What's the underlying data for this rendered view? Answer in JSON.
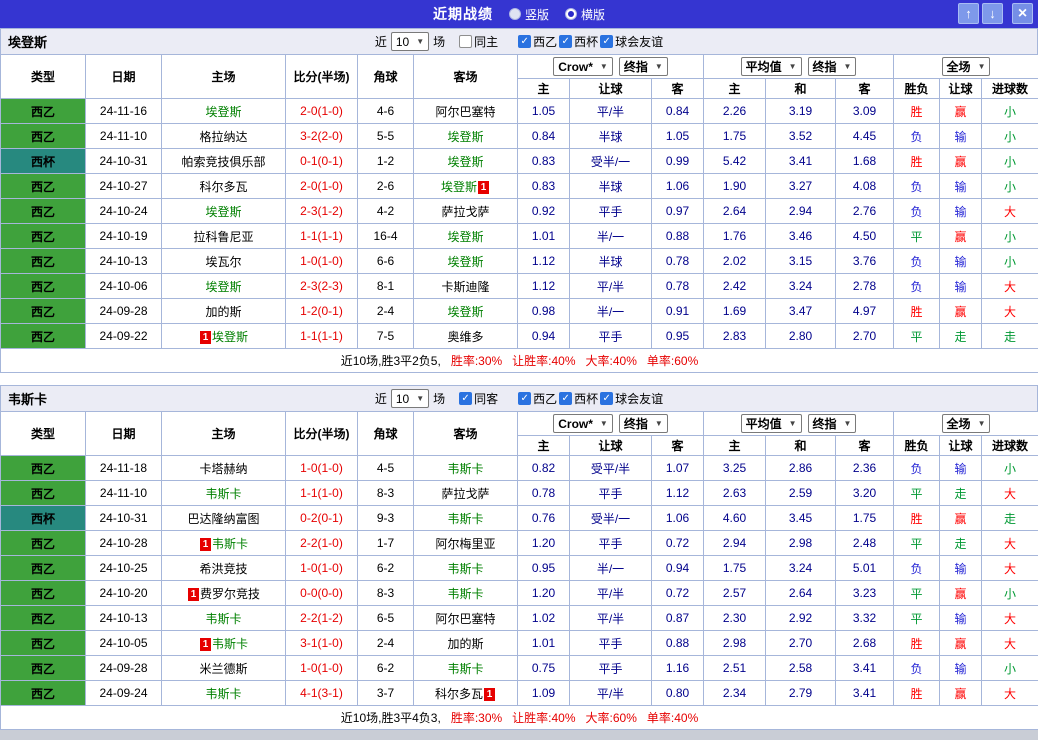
{
  "titlebar": {
    "title": "近期战绩",
    "radio_vertical": "竖版",
    "radio_horizontal": "横版",
    "selected_layout": "横版",
    "up_icon": "↑",
    "down_icon": "↓",
    "close_icon": "×"
  },
  "filter": {
    "near_label": "近",
    "near_value": "10",
    "games_label": "场",
    "leagues": [
      {
        "label": "西乙",
        "checked": true
      },
      {
        "label": "西杯",
        "checked": true
      },
      {
        "label": "球会友谊",
        "checked": true
      }
    ]
  },
  "columns": {
    "main": [
      "类型",
      "日期",
      "主场",
      "比分(半场)",
      "角球",
      "客场"
    ],
    "asia": [
      "主",
      "让球",
      "客"
    ],
    "europe": [
      "主",
      "和",
      "客"
    ],
    "result": [
      "胜负",
      "让球",
      "进球数"
    ]
  },
  "odds_header": {
    "bookmaker": "Crow*",
    "asia_final": "终指",
    "average": "平均值",
    "europe_final": "终指",
    "scope": "全场"
  },
  "colors": {
    "accent": "#3535d1",
    "score": "#e60000",
    "focus_team": "#008000",
    "odds": "#00008b",
    "summary_stat": "#e60000",
    "league_map": {
      "西乙": "#3fa23c",
      "西杯": "#27897f"
    },
    "result_map": {
      "胜": "#ff0000",
      "赢": "#ff0000",
      "大": "#ff0000",
      "负": "#2323d5",
      "输": "#2323d5",
      "平": "#009933",
      "走": "#009933",
      "小": "#009933"
    }
  },
  "sections": [
    {
      "team": "埃登斯",
      "same": {
        "label": "同主",
        "checked": false
      },
      "rows": [
        {
          "lg": "西乙",
          "date": "24-11-16",
          "home": "埃登斯",
          "hb": "",
          "score": "2-0(1-0)",
          "cor": "4-6",
          "away": "阿尔巴塞特",
          "ab": "",
          "asia": [
            "1.05",
            "平/半",
            "0.84"
          ],
          "eu": [
            "2.26",
            "3.19",
            "3.09"
          ],
          "res": [
            "胜",
            "赢",
            "小"
          ]
        },
        {
          "lg": "西乙",
          "date": "24-11-10",
          "home": "格拉纳达",
          "hb": "",
          "score": "3-2(2-0)",
          "cor": "5-5",
          "away": "埃登斯",
          "ab": "",
          "asia": [
            "0.84",
            "半球",
            "1.05"
          ],
          "eu": [
            "1.75",
            "3.52",
            "4.45"
          ],
          "res": [
            "负",
            "输",
            "小"
          ]
        },
        {
          "lg": "西杯",
          "date": "24-10-31",
          "home": "帕索竞技俱乐部",
          "hb": "",
          "score": "0-1(0-1)",
          "cor": "1-2",
          "away": "埃登斯",
          "ab": "",
          "asia": [
            "0.83",
            "受半/一",
            "0.99"
          ],
          "eu": [
            "5.42",
            "3.41",
            "1.68"
          ],
          "res": [
            "胜",
            "赢",
            "小"
          ]
        },
        {
          "lg": "西乙",
          "date": "24-10-27",
          "home": "科尔多瓦",
          "hb": "",
          "score": "2-0(1-0)",
          "cor": "2-6",
          "away": "埃登斯",
          "ab": "1",
          "asia": [
            "0.83",
            "半球",
            "1.06"
          ],
          "eu": [
            "1.90",
            "3.27",
            "4.08"
          ],
          "res": [
            "负",
            "输",
            "小"
          ]
        },
        {
          "lg": "西乙",
          "date": "24-10-24",
          "home": "埃登斯",
          "hb": "",
          "score": "2-3(1-2)",
          "cor": "4-2",
          "away": "萨拉戈萨",
          "ab": "",
          "asia": [
            "0.92",
            "平手",
            "0.97"
          ],
          "eu": [
            "2.64",
            "2.94",
            "2.76"
          ],
          "res": [
            "负",
            "输",
            "大"
          ]
        },
        {
          "lg": "西乙",
          "date": "24-10-19",
          "home": "拉科鲁尼亚",
          "hb": "",
          "score": "1-1(1-1)",
          "cor": "16-4",
          "away": "埃登斯",
          "ab": "",
          "asia": [
            "1.01",
            "半/一",
            "0.88"
          ],
          "eu": [
            "1.76",
            "3.46",
            "4.50"
          ],
          "res": [
            "平",
            "赢",
            "小"
          ]
        },
        {
          "lg": "西乙",
          "date": "24-10-13",
          "home": "埃瓦尔",
          "hb": "",
          "score": "1-0(1-0)",
          "cor": "6-6",
          "away": "埃登斯",
          "ab": "",
          "asia": [
            "1.12",
            "半球",
            "0.78"
          ],
          "eu": [
            "2.02",
            "3.15",
            "3.76"
          ],
          "res": [
            "负",
            "输",
            "小"
          ]
        },
        {
          "lg": "西乙",
          "date": "24-10-06",
          "home": "埃登斯",
          "hb": "",
          "score": "2-3(2-3)",
          "cor": "8-1",
          "away": "卡斯迪隆",
          "ab": "",
          "asia": [
            "1.12",
            "平/半",
            "0.78"
          ],
          "eu": [
            "2.42",
            "3.24",
            "2.78"
          ],
          "res": [
            "负",
            "输",
            "大"
          ]
        },
        {
          "lg": "西乙",
          "date": "24-09-28",
          "home": "加的斯",
          "hb": "",
          "score": "1-2(0-1)",
          "cor": "2-4",
          "away": "埃登斯",
          "ab": "",
          "asia": [
            "0.98",
            "半/一",
            "0.91"
          ],
          "eu": [
            "1.69",
            "3.47",
            "4.97"
          ],
          "res": [
            "胜",
            "赢",
            "大"
          ]
        },
        {
          "lg": "西乙",
          "date": "24-09-22",
          "home": "埃登斯",
          "hb": "1",
          "score": "1-1(1-1)",
          "cor": "7-5",
          "away": "奥维多",
          "ab": "",
          "asia": [
            "0.94",
            "平手",
            "0.95"
          ],
          "eu": [
            "2.83",
            "2.80",
            "2.70"
          ],
          "res": [
            "平",
            "走",
            "走"
          ]
        }
      ],
      "summary": {
        "prefix": "近10场,胜3平2负5,",
        "stats": [
          "胜率:30%",
          "让胜率:40%",
          "大率:40%",
          "单率:60%"
        ]
      }
    },
    {
      "team": "韦斯卡",
      "same": {
        "label": "同客",
        "checked": true
      },
      "rows": [
        {
          "lg": "西乙",
          "date": "24-11-18",
          "home": "卡塔赫纳",
          "hb": "",
          "score": "1-0(1-0)",
          "cor": "4-5",
          "away": "韦斯卡",
          "ab": "",
          "asia": [
            "0.82",
            "受平/半",
            "1.07"
          ],
          "eu": [
            "3.25",
            "2.86",
            "2.36"
          ],
          "res": [
            "负",
            "输",
            "小"
          ]
        },
        {
          "lg": "西乙",
          "date": "24-11-10",
          "home": "韦斯卡",
          "hb": "",
          "score": "1-1(1-0)",
          "cor": "8-3",
          "away": "萨拉戈萨",
          "ab": "",
          "asia": [
            "0.78",
            "平手",
            "1.12"
          ],
          "eu": [
            "2.63",
            "2.59",
            "3.20"
          ],
          "res": [
            "平",
            "走",
            "大"
          ]
        },
        {
          "lg": "西杯",
          "date": "24-10-31",
          "home": "巴达隆纳富图",
          "hb": "",
          "score": "0-2(0-1)",
          "cor": "9-3",
          "away": "韦斯卡",
          "ab": "",
          "asia": [
            "0.76",
            "受半/一",
            "1.06"
          ],
          "eu": [
            "4.60",
            "3.45",
            "1.75"
          ],
          "res": [
            "胜",
            "赢",
            "走"
          ]
        },
        {
          "lg": "西乙",
          "date": "24-10-28",
          "home": "韦斯卡",
          "hb": "1",
          "score": "2-2(1-0)",
          "cor": "1-7",
          "away": "阿尔梅里亚",
          "ab": "",
          "asia": [
            "1.20",
            "平手",
            "0.72"
          ],
          "eu": [
            "2.94",
            "2.98",
            "2.48"
          ],
          "res": [
            "平",
            "走",
            "大"
          ]
        },
        {
          "lg": "西乙",
          "date": "24-10-25",
          "home": "希洪竞技",
          "hb": "",
          "score": "1-0(1-0)",
          "cor": "6-2",
          "away": "韦斯卡",
          "ab": "",
          "asia": [
            "0.95",
            "半/一",
            "0.94"
          ],
          "eu": [
            "1.75",
            "3.24",
            "5.01"
          ],
          "res": [
            "负",
            "输",
            "大"
          ]
        },
        {
          "lg": "西乙",
          "date": "24-10-20",
          "home": "费罗尔竞技",
          "hb": "1",
          "score": "0-0(0-0)",
          "cor": "8-3",
          "away": "韦斯卡",
          "ab": "",
          "asia": [
            "1.20",
            "平/半",
            "0.72"
          ],
          "eu": [
            "2.57",
            "2.64",
            "3.23"
          ],
          "res": [
            "平",
            "赢",
            "小"
          ]
        },
        {
          "lg": "西乙",
          "date": "24-10-13",
          "home": "韦斯卡",
          "hb": "",
          "score": "2-2(1-2)",
          "cor": "6-5",
          "away": "阿尔巴塞特",
          "ab": "",
          "asia": [
            "1.02",
            "平/半",
            "0.87"
          ],
          "eu": [
            "2.30",
            "2.92",
            "3.32"
          ],
          "res": [
            "平",
            "输",
            "大"
          ]
        },
        {
          "lg": "西乙",
          "date": "24-10-05",
          "home": "韦斯卡",
          "hb": "1",
          "score": "3-1(1-0)",
          "cor": "2-4",
          "away": "加的斯",
          "ab": "",
          "asia": [
            "1.01",
            "平手",
            "0.88"
          ],
          "eu": [
            "2.98",
            "2.70",
            "2.68"
          ],
          "res": [
            "胜",
            "赢",
            "大"
          ]
        },
        {
          "lg": "西乙",
          "date": "24-09-28",
          "home": "米兰德斯",
          "hb": "",
          "score": "1-0(1-0)",
          "cor": "6-2",
          "away": "韦斯卡",
          "ab": "",
          "asia": [
            "0.75",
            "平手",
            "1.16"
          ],
          "eu": [
            "2.51",
            "2.58",
            "3.41"
          ],
          "res": [
            "负",
            "输",
            "小"
          ]
        },
        {
          "lg": "西乙",
          "date": "24-09-24",
          "home": "韦斯卡",
          "hb": "",
          "score": "4-1(3-1)",
          "cor": "3-7",
          "away": "科尔多瓦",
          "ab": "1",
          "asia": [
            "1.09",
            "平/半",
            "0.80"
          ],
          "eu": [
            "2.34",
            "2.79",
            "3.41"
          ],
          "res": [
            "胜",
            "赢",
            "大"
          ]
        }
      ],
      "summary": {
        "prefix": "近10场,胜3平4负3,",
        "stats": [
          "胜率:30%",
          "让胜率:40%",
          "大率:60%",
          "单率:40%"
        ]
      }
    }
  ]
}
